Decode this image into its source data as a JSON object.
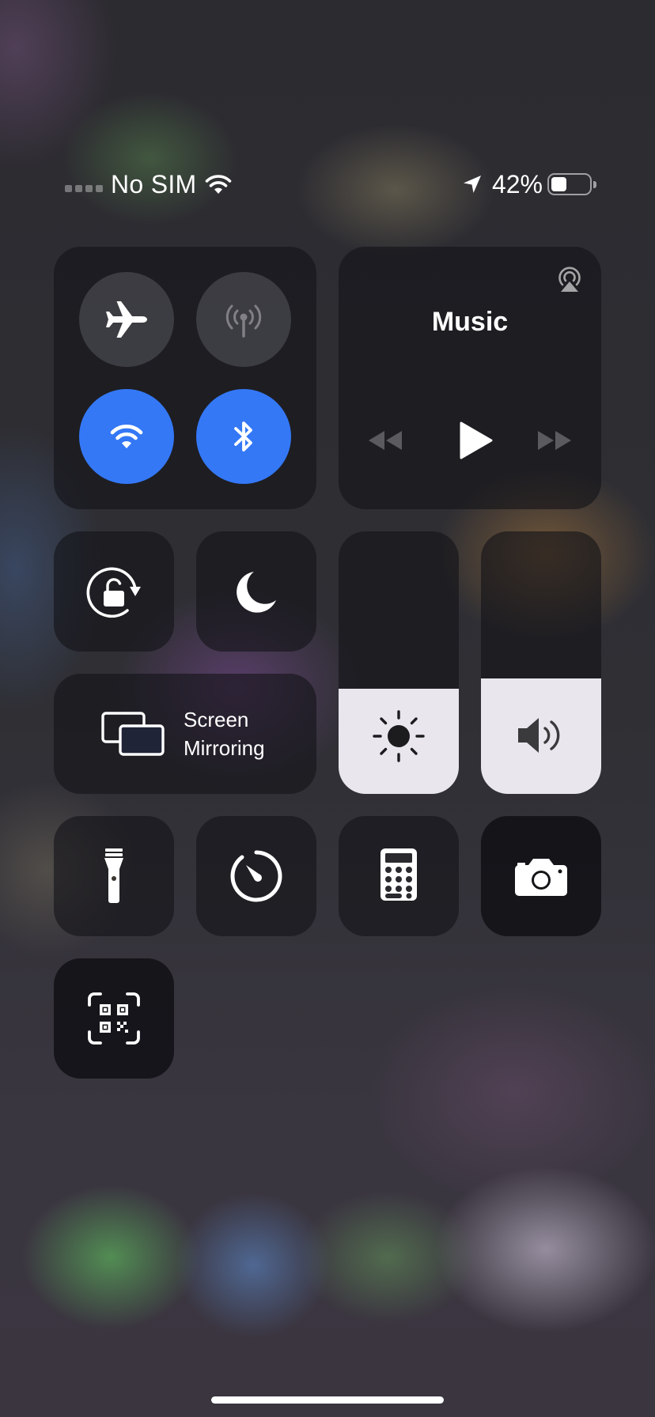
{
  "status_bar": {
    "carrier": "No SIM",
    "battery_percent": "42%",
    "battery_level": 0.42,
    "icons": [
      "signal-dots",
      "wifi-icon",
      "location-arrow-icon",
      "battery-icon"
    ]
  },
  "connectivity": {
    "airplane_mode": {
      "icon": "airplane-icon",
      "on": false
    },
    "cellular_data": {
      "icon": "antenna-icon",
      "on": false,
      "disabled": true
    },
    "wifi": {
      "icon": "wifi-icon",
      "on": true
    },
    "bluetooth": {
      "icon": "bluetooth-icon",
      "on": true
    },
    "active_color": "#3478f6"
  },
  "now_playing": {
    "title": "Music",
    "controls": [
      "rewind-icon",
      "play-icon",
      "fast-forward-icon"
    ],
    "airplay_icon": "airplay-audio-icon"
  },
  "toggles": {
    "rotation_lock": {
      "icon": "rotation-lock-icon"
    },
    "do_not_disturb": {
      "icon": "moon-icon"
    }
  },
  "screen_mirroring": {
    "line1": "Screen",
    "line2": "Mirroring",
    "icon": "screen-mirroring-icon"
  },
  "sliders": {
    "brightness": {
      "icon": "sun-icon",
      "level": 0.4
    },
    "volume": {
      "icon": "speaker-icon",
      "level": 0.44
    }
  },
  "shortcuts": [
    {
      "name": "Flashlight",
      "icon": "flashlight-icon"
    },
    {
      "name": "Timer",
      "icon": "timer-icon"
    },
    {
      "name": "Calculator",
      "icon": "calculator-icon"
    },
    {
      "name": "Camera",
      "icon": "camera-icon"
    },
    {
      "name": "Scan QR Code",
      "icon": "qr-code-icon"
    }
  ]
}
